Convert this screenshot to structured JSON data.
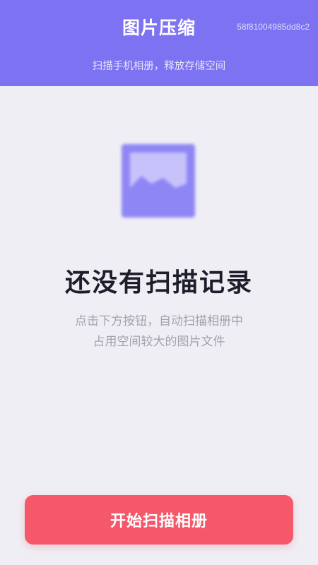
{
  "header": {
    "title": "图片压缩",
    "id_text": "58f81004985dd8c2",
    "subtitle": "扫描手机相册，释放存储空间"
  },
  "empty_state": {
    "icon": "image-icon",
    "title": "还没有扫描记录",
    "description_lines": [
      "点击下方按钮，自动扫描相册中",
      "占用空间较大的图片文件"
    ]
  },
  "actions": {
    "scan_button_label": "开始扫描相册"
  },
  "colors": {
    "header_bg": "#7d72f1",
    "page_bg": "#efeef4",
    "accent_button": "#f55868",
    "icon_color": "#8f86f5"
  }
}
